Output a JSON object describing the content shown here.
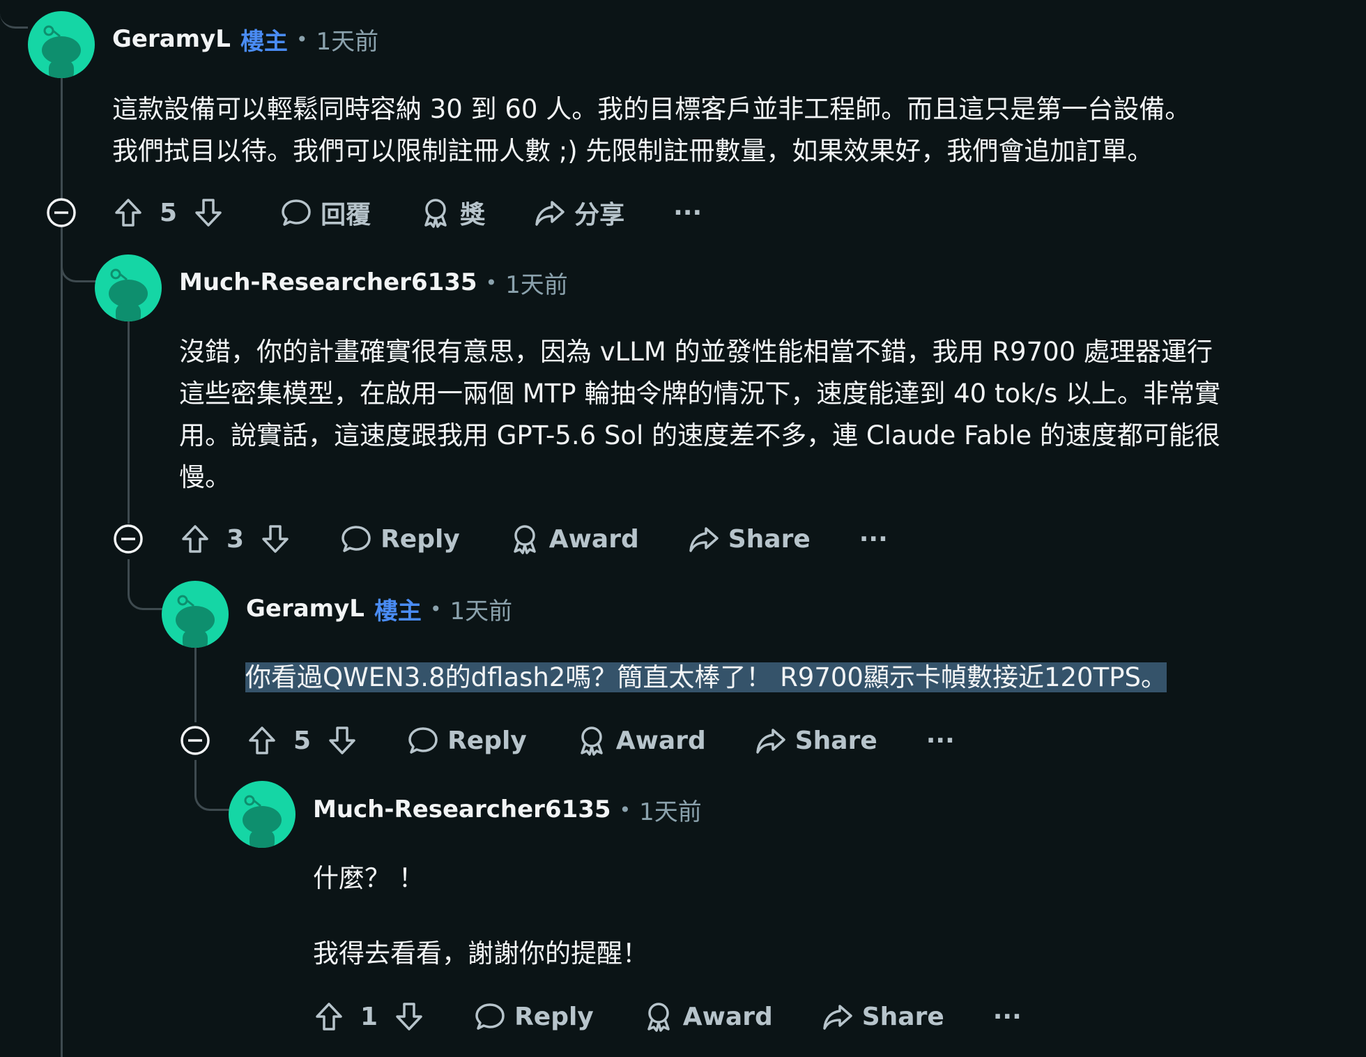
{
  "colors": {
    "background": "#0b1416",
    "avatar": "#15d6a5",
    "op_badge": "#4a8cf5",
    "highlight": "#35536a",
    "muted": "#8ba2ad"
  },
  "icons": {
    "upvote": "arrow-up-icon",
    "downvote": "arrow-down-icon",
    "reply": "speech-bubble-icon",
    "award": "award-ribbon-icon",
    "share": "share-arrow-icon",
    "more": "more-dots-icon",
    "collapse": "collapse-minus-icon"
  },
  "comments": [
    {
      "username": "GeramyL",
      "op_badge": "樓主",
      "separator": "•",
      "time": "1天前",
      "body": [
        "這款設備可以輕鬆同時容納 30 到 60 人。我的目標客戶並非工程師。而且這只是第一台設備。",
        "我們拭目以待。我們可以限制註冊人數 ;) 先限制註冊數量，如果效果好，我們會追加訂單。"
      ],
      "score": "5",
      "reply_label": "回覆",
      "award_label": "獎",
      "share_label": "分享",
      "more_label": "···"
    },
    {
      "username": "Much-Researcher6135",
      "separator": "•",
      "time": "1天前",
      "body": [
        "沒錯，你的計畫確實很有意思，因為 vLLM 的並發性能相當不錯，我用 R9700 處理器運行",
        "這些密集模型，在啟用一兩個 MTP 輪抽令牌的情況下，速度能達到 40 tok/s 以上。非常實",
        "用。說實話，這速度跟我用 GPT-5.6 Sol 的速度差不多，連 Claude Fable 的速度都可能很",
        "慢。"
      ],
      "score": "3",
      "reply_label": "Reply",
      "award_label": "Award",
      "share_label": "Share",
      "more_label": "···"
    },
    {
      "username": "GeramyL",
      "op_badge": "樓主",
      "separator": "•",
      "time": "1天前",
      "body": [
        "你看過QWEN3.8的dflash2嗎？簡直太棒了！ R9700顯示卡幀數接近120TPS。"
      ],
      "score": "5",
      "reply_label": "Reply",
      "award_label": "Award",
      "share_label": "Share",
      "more_label": "···"
    },
    {
      "username": "Much-Researcher6135",
      "separator": "•",
      "time": "1天前",
      "body": [
        "什麼？ ！",
        "我得去看看，謝謝你的提醒！"
      ],
      "score": "1",
      "reply_label": "Reply",
      "award_label": "Award",
      "share_label": "Share",
      "more_label": "···"
    }
  ]
}
